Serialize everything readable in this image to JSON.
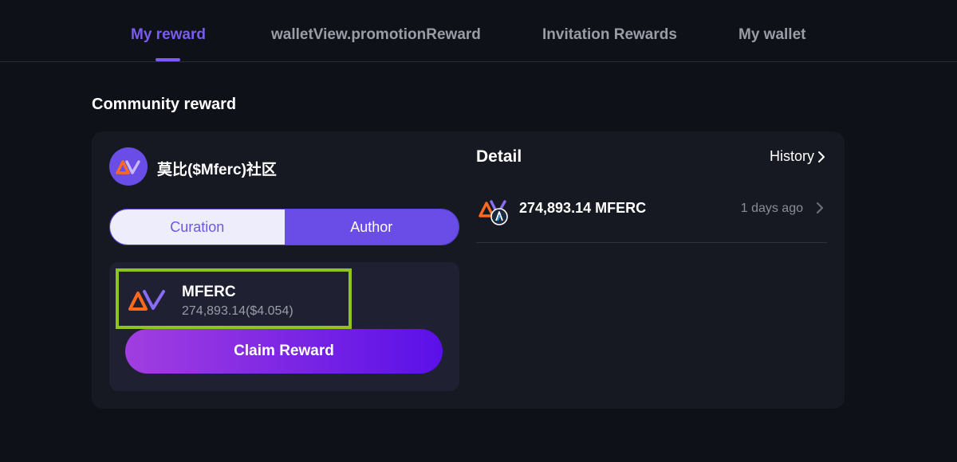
{
  "tabs": [
    {
      "label": "My reward",
      "active": true
    },
    {
      "label": "walletView.promotionReward",
      "active": false
    },
    {
      "label": "Invitation Rewards",
      "active": false
    },
    {
      "label": "My wallet",
      "active": false
    }
  ],
  "section": {
    "title": "Community reward"
  },
  "community": {
    "name": "莫比($Mferc)社区",
    "logo_icon": "mferc-logo-icon"
  },
  "toggle": {
    "curation_label": "Curation",
    "author_label": "Author",
    "selected": "Author"
  },
  "reward": {
    "token_name": "MFERC",
    "token_amount": "274,893.14($4.054)",
    "claim_label": "Claim Reward"
  },
  "detail": {
    "title": "Detail",
    "history_label": "History",
    "rows": [
      {
        "amount": "274,893.14 MFERC",
        "time": "1 days ago"
      }
    ]
  },
  "colors": {
    "accent": "#7b5cf0",
    "background": "#0f1118",
    "card": "#161922",
    "highlight": "#8fc31f",
    "logo_orange": "#ff6a1a",
    "logo_purple": "#8b6cf5"
  }
}
